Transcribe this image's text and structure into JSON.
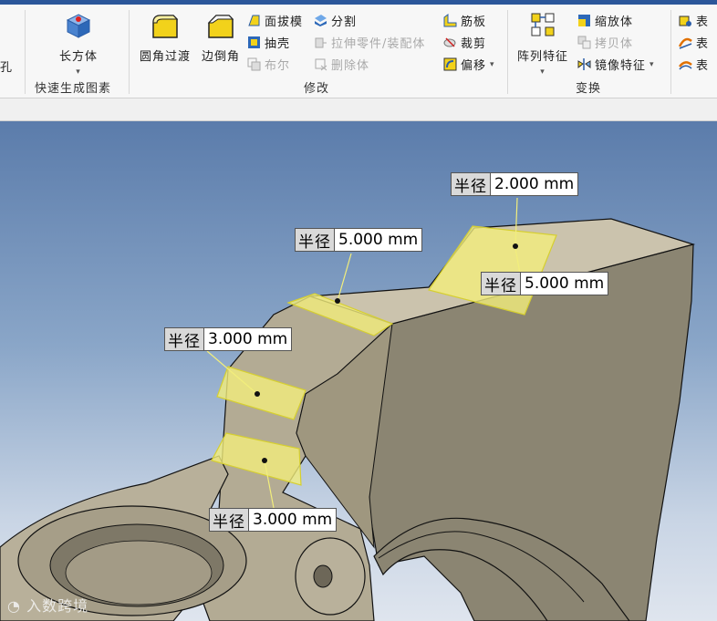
{
  "ribbon": {
    "left_cut_label": "孔",
    "quick": {
      "button": "长方体",
      "group": "快速生成图素"
    },
    "modify": {
      "big": [
        "圆角过渡",
        "边倒角"
      ],
      "col1": [
        "面拔模",
        "抽壳",
        "布尔"
      ],
      "col2": [
        "分割",
        "拉伸零件/装配体",
        "删除体"
      ],
      "col3": [
        "筋板",
        "裁剪",
        "偏移"
      ],
      "group": "修改"
    },
    "transform": {
      "big": "阵列特征",
      "items": [
        "缩放体",
        "拷贝体",
        "镜像特征"
      ],
      "group": "变换"
    },
    "right_cut": [
      "表",
      "表",
      "表"
    ]
  },
  "dimensions": [
    {
      "key": "半径",
      "value": "2.000 mm"
    },
    {
      "key": "半径",
      "value": "5.000 mm"
    },
    {
      "key": "半径",
      "value": "5.000 mm"
    },
    {
      "key": "半径",
      "value": "3.000 mm"
    },
    {
      "key": "半径",
      "value": "3.000 mm"
    }
  ],
  "watermark": "入数跨境",
  "colors": {
    "ribbon_top": "#2b579a",
    "fillet_highlight": "#f2ee7c",
    "model": "#a49c87"
  }
}
